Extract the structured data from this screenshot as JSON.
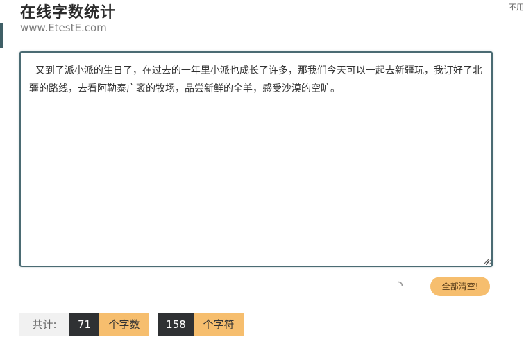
{
  "header": {
    "title": "在线字数统计",
    "url": "www.EtestE.com",
    "corner_hint": "不用"
  },
  "editor": {
    "text": "  又到了派小派的生日了，在过去的一年里小派也成长了许多，那我们今天可以一起去新疆玩，我订好了北疆的路线，去看阿勒泰广袤的牧场，品尝新鲜的全羊，感受沙漠的空旷。"
  },
  "actions": {
    "clear_label": "全部清空!"
  },
  "stats": {
    "total_label": "共计:",
    "char_count": "71",
    "char_unit": "个字数",
    "symbol_count": "158",
    "symbol_unit": "个字符"
  },
  "colors": {
    "accent": "#4b6b73",
    "orange": "#f6be6e",
    "dark": "#2f3133"
  }
}
